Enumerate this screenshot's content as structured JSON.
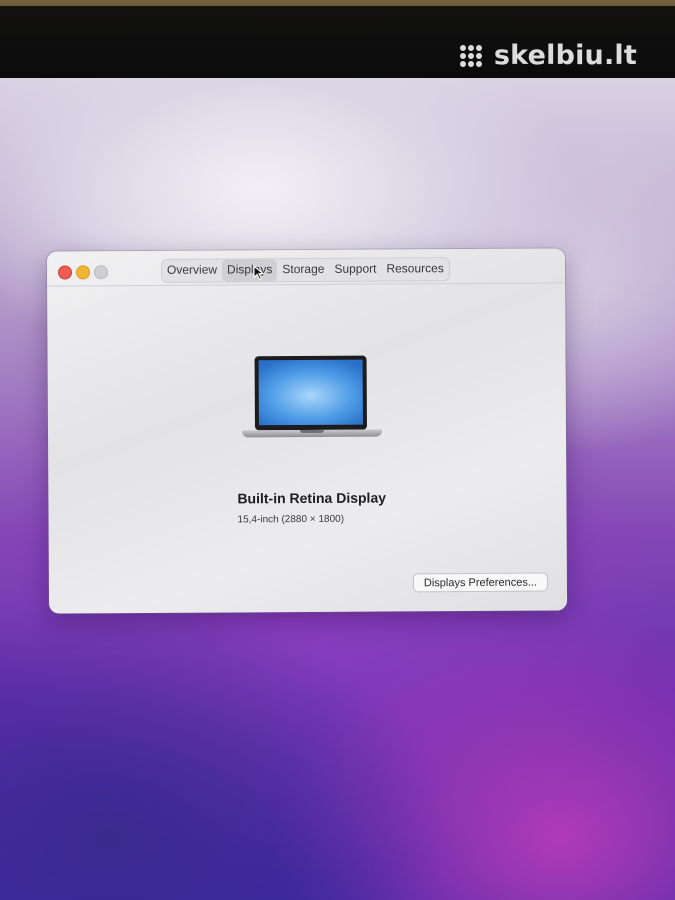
{
  "watermark": {
    "text": "skelbiu.lt"
  },
  "window": {
    "tabs": [
      {
        "label": "Overview",
        "active": false
      },
      {
        "label": "Displays",
        "active": true
      },
      {
        "label": "Storage",
        "active": false
      },
      {
        "label": "Support",
        "active": false
      },
      {
        "label": "Resources",
        "active": false
      }
    ],
    "display": {
      "name": "Built-in Retina Display",
      "resolution": "15,4-inch (2880 × 1800)"
    },
    "preferences_button": "Displays Preferences..."
  },
  "colors": {
    "close": "#ec5b54",
    "minimize": "#f0b534",
    "zoom_disabled": "#cfcfd2"
  }
}
